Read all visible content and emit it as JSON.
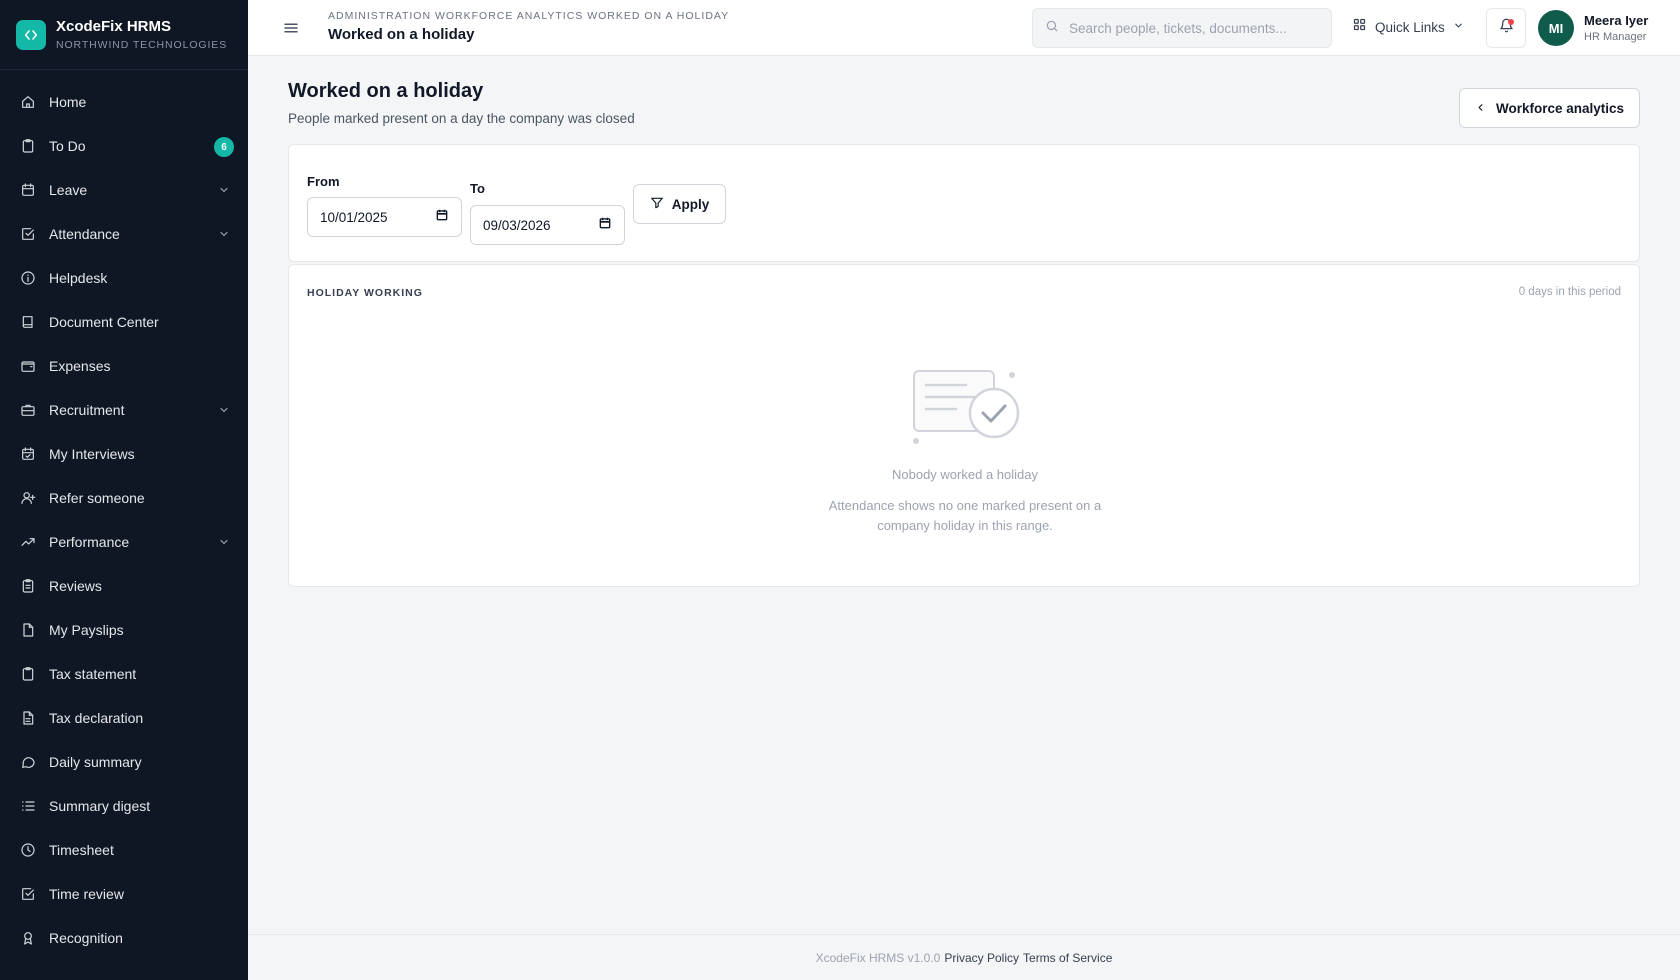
{
  "brand": {
    "title": "XcodeFix HRMS",
    "subtitle": "NORTHWIND TECHNOLOGIES"
  },
  "sidebar": {
    "items": [
      {
        "label": "Home",
        "icon": "home-icon"
      },
      {
        "label": "To Do",
        "icon": "clipboard-icon",
        "badge": "6"
      },
      {
        "label": "Leave",
        "icon": "calendar-icon",
        "expandable": true
      },
      {
        "label": "Attendance",
        "icon": "check-square-icon",
        "expandable": true
      },
      {
        "label": "Helpdesk",
        "icon": "info-icon"
      },
      {
        "label": "Document Center",
        "icon": "book-icon"
      },
      {
        "label": "Expenses",
        "icon": "wallet-icon"
      },
      {
        "label": "Recruitment",
        "icon": "briefcase-icon",
        "expandable": true
      },
      {
        "label": "My Interviews",
        "icon": "calendar-check-icon"
      },
      {
        "label": "Refer someone",
        "icon": "user-plus-icon"
      },
      {
        "label": "Performance",
        "icon": "trending-up-icon",
        "expandable": true
      },
      {
        "label": "Reviews",
        "icon": "clipboard-list-icon"
      },
      {
        "label": "My Payslips",
        "icon": "file-icon"
      },
      {
        "label": "Tax statement",
        "icon": "clipboard-icon"
      },
      {
        "label": "Tax declaration",
        "icon": "file-text-icon"
      },
      {
        "label": "Daily summary",
        "icon": "message-circle-icon"
      },
      {
        "label": "Summary digest",
        "icon": "list-icon"
      },
      {
        "label": "Timesheet",
        "icon": "clock-icon"
      },
      {
        "label": "Time review",
        "icon": "check-square-icon"
      },
      {
        "label": "Recognition",
        "icon": "award-icon"
      }
    ]
  },
  "header": {
    "breadcrumb": "ADMINISTRATION WORKFORCE ANALYTICS WORKED ON A HOLIDAY",
    "title": "Worked on a holiday",
    "search_placeholder": "Search people, tickets, documents...",
    "quick_links": "Quick Links",
    "user_initials": "MI",
    "user_name": "Meera Iyer",
    "user_role": "HR Manager"
  },
  "page": {
    "title": "Worked on a holiday",
    "subtitle": "People marked present on a day the company was closed",
    "back_label": "Workforce analytics"
  },
  "filter": {
    "from_label": "From",
    "from_value": "10/01/2025",
    "to_label": "To",
    "to_value": "09/03/2026",
    "apply_label": "Apply"
  },
  "results": {
    "section_label": "HOLIDAY WORKING",
    "count_label": "0 days in this period",
    "empty_title": "Nobody worked a holiday",
    "empty_desc": "Attendance shows no one marked present on a company holiday in this range."
  },
  "footer": {
    "version": "XcodeFix HRMS v1.0.0",
    "privacy": "Privacy Policy",
    "terms": "Terms of Service"
  },
  "colors": {
    "sidebar_bg": "#0f1724",
    "accent": "#14b8a6",
    "avatar_bg": "#0f5b4c",
    "notification": "#ef4444"
  }
}
